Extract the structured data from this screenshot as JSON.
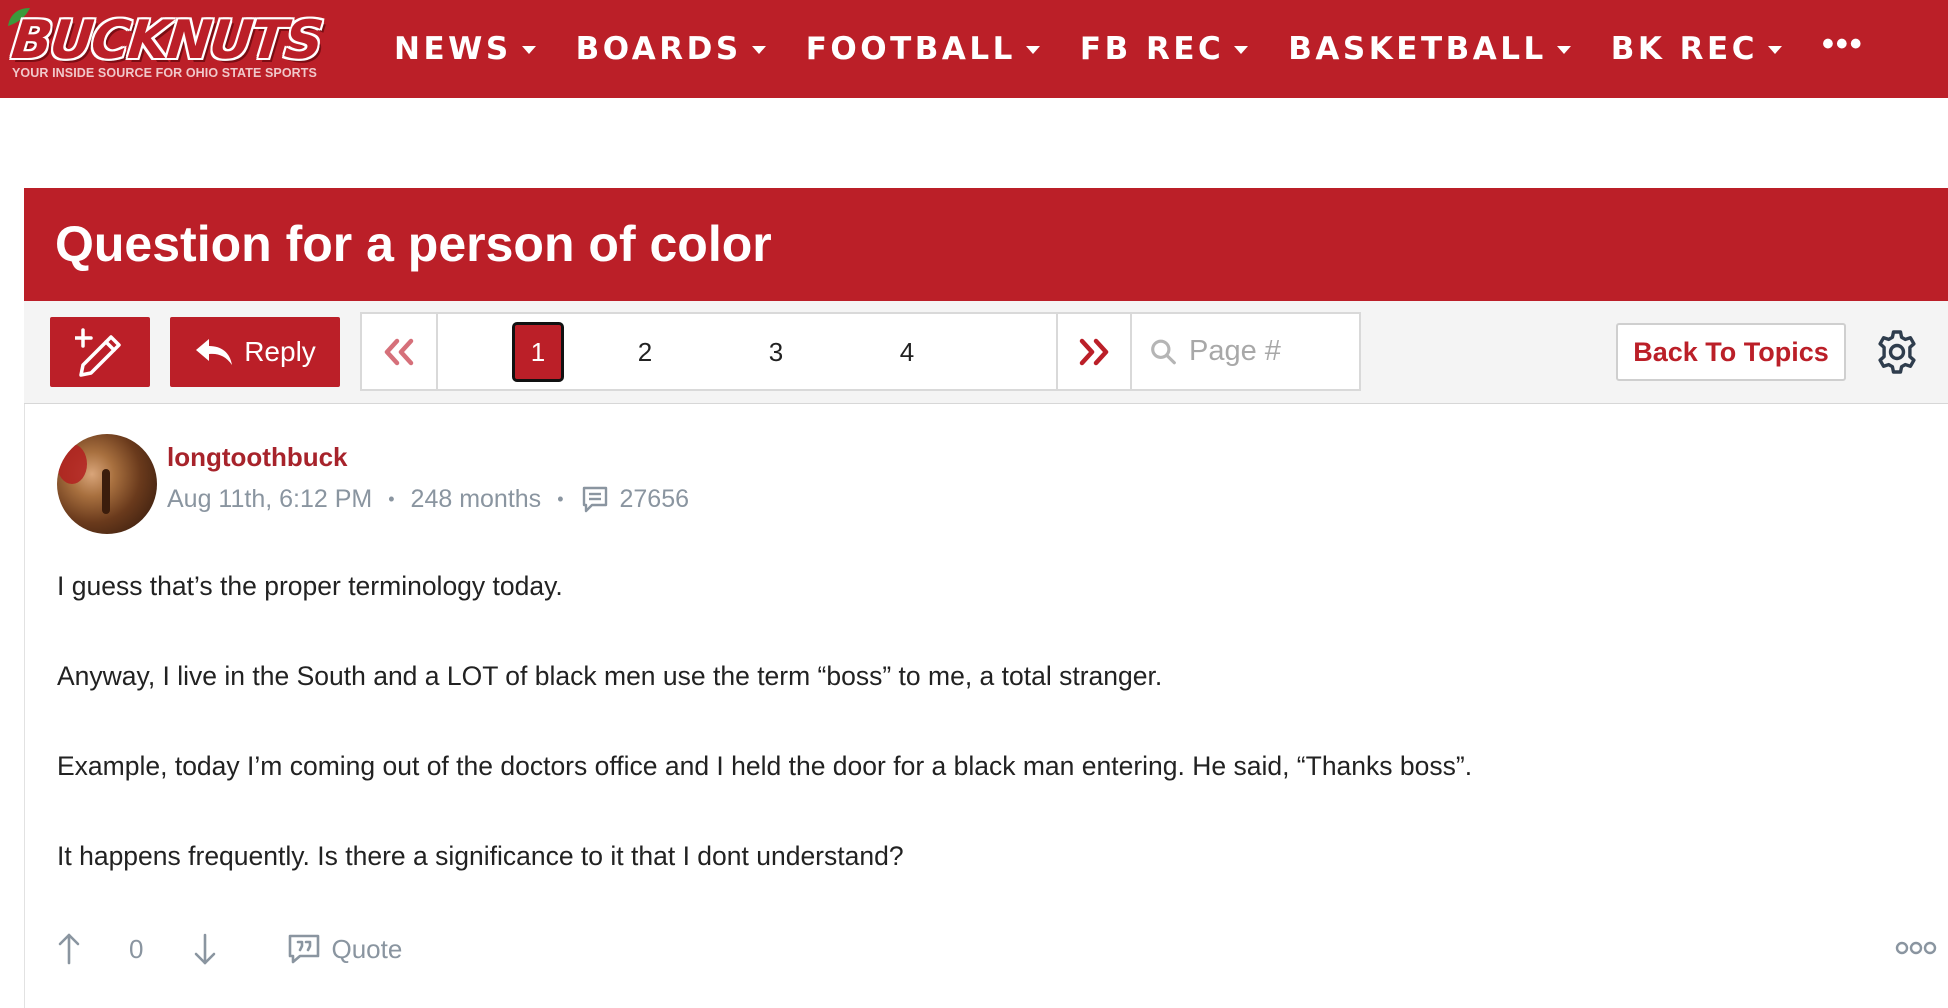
{
  "site": {
    "logo_text": "BUCKNUTS",
    "tagline": "YOUR INSIDE SOURCE FOR OHIO STATE SPORTS"
  },
  "nav": {
    "items": [
      {
        "label": "NEWS"
      },
      {
        "label": "BOARDS"
      },
      {
        "label": "FOOTBALL"
      },
      {
        "label": "FB REC"
      },
      {
        "label": "BASKETBALL"
      },
      {
        "label": "BK REC"
      }
    ],
    "more_label": "•••"
  },
  "thread": {
    "title": "Question for a person of color"
  },
  "toolbar": {
    "new_post_icon": "new-post-pencil-icon",
    "reply_label": "Reply",
    "pages": [
      "1",
      "2",
      "3",
      "4"
    ],
    "current_page": "1",
    "page_search_placeholder": "Page #",
    "back_label": "Back To Topics",
    "settings_icon": "gear-icon"
  },
  "post": {
    "username": "longtoothbuck",
    "timestamp": "Aug 11th, 6:12 PM",
    "tenure": "248 months",
    "post_count": "27656",
    "paragraphs": [
      "I guess that’s the proper terminology today.",
      "Anyway, I live in the South and a LOT of black men use the term “boss” to me, a total stranger.",
      "Example, today I’m coming out of the doctors office and I held the door for a black man entering. He said, “Thanks boss”.",
      "It happens frequently. Is there a significance to it that I dont understand?"
    ],
    "vote_count": "0",
    "quote_label": "Quote"
  },
  "colors": {
    "brand_red": "#bb1f28",
    "muted_text": "#8a95a0"
  }
}
